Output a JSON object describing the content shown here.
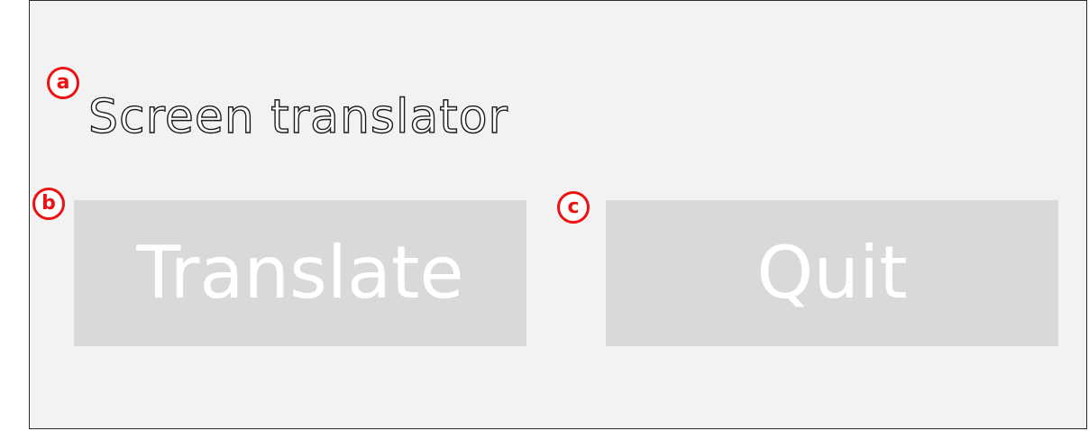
{
  "app": {
    "title": "Screen translator"
  },
  "buttons": {
    "translate_label": "Translate",
    "quit_label": "Quit"
  },
  "annotations": {
    "a": "a",
    "b": "b",
    "c": "c"
  },
  "colors": {
    "window_background": "#f2f2f2",
    "button_background": "#d9d9d9",
    "button_text": "#ffffff",
    "title_outline": "#1a1a1a",
    "annotation_red": "#ee1111"
  }
}
